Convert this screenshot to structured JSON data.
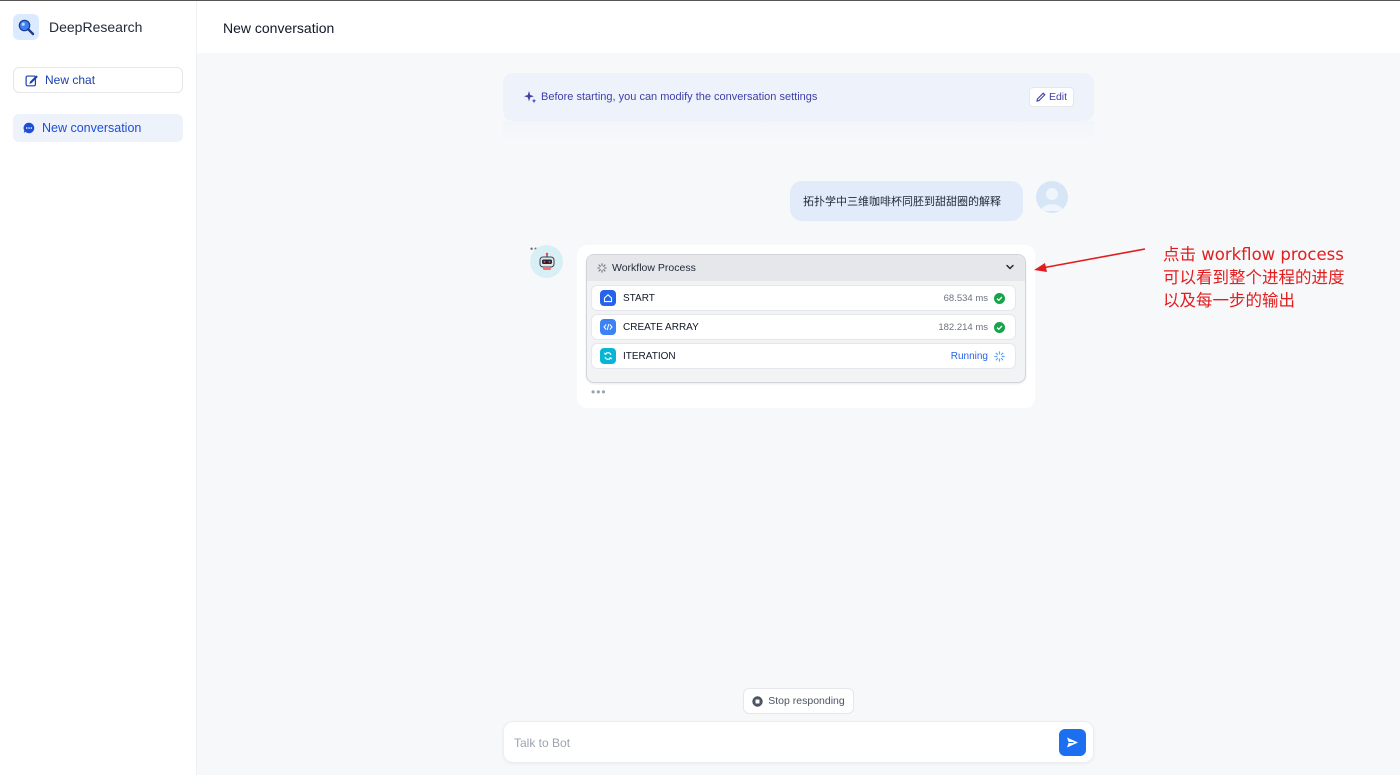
{
  "app": {
    "name": "DeepResearch"
  },
  "sidebar": {
    "new_chat_label": "New chat",
    "conversations": [
      {
        "label": "New conversation"
      }
    ]
  },
  "header": {
    "title": "New conversation"
  },
  "settings_banner": {
    "text": "Before starting, you can modify the conversation settings",
    "edit_label": "Edit"
  },
  "messages": {
    "user": {
      "text": "拓扑学中三维咖啡杯同胚到甜甜圈的解释"
    },
    "bot": {
      "workflow": {
        "title": "Workflow Process",
        "nodes": [
          {
            "name": "START",
            "time": "68.534 ms",
            "status": "success",
            "icon": "home-icon"
          },
          {
            "name": "CREATE ARRAY",
            "time": "182.214 ms",
            "status": "success",
            "icon": "code-icon"
          },
          {
            "name": "ITERATION",
            "time": "",
            "status_text": "Running",
            "status": "running",
            "icon": "loop-icon"
          }
        ]
      }
    }
  },
  "annotation": {
    "lines": [
      "点击 workflow process",
      "可以看到整个进程的进度",
      "以及每一步的输出"
    ]
  },
  "composer": {
    "stop_label": "Stop responding",
    "placeholder": "Talk to Bot"
  },
  "colors": {
    "accent": "#1d4ed8",
    "send": "#1d6ff2",
    "success": "#16a34a",
    "annotation": "#e11d1d"
  }
}
